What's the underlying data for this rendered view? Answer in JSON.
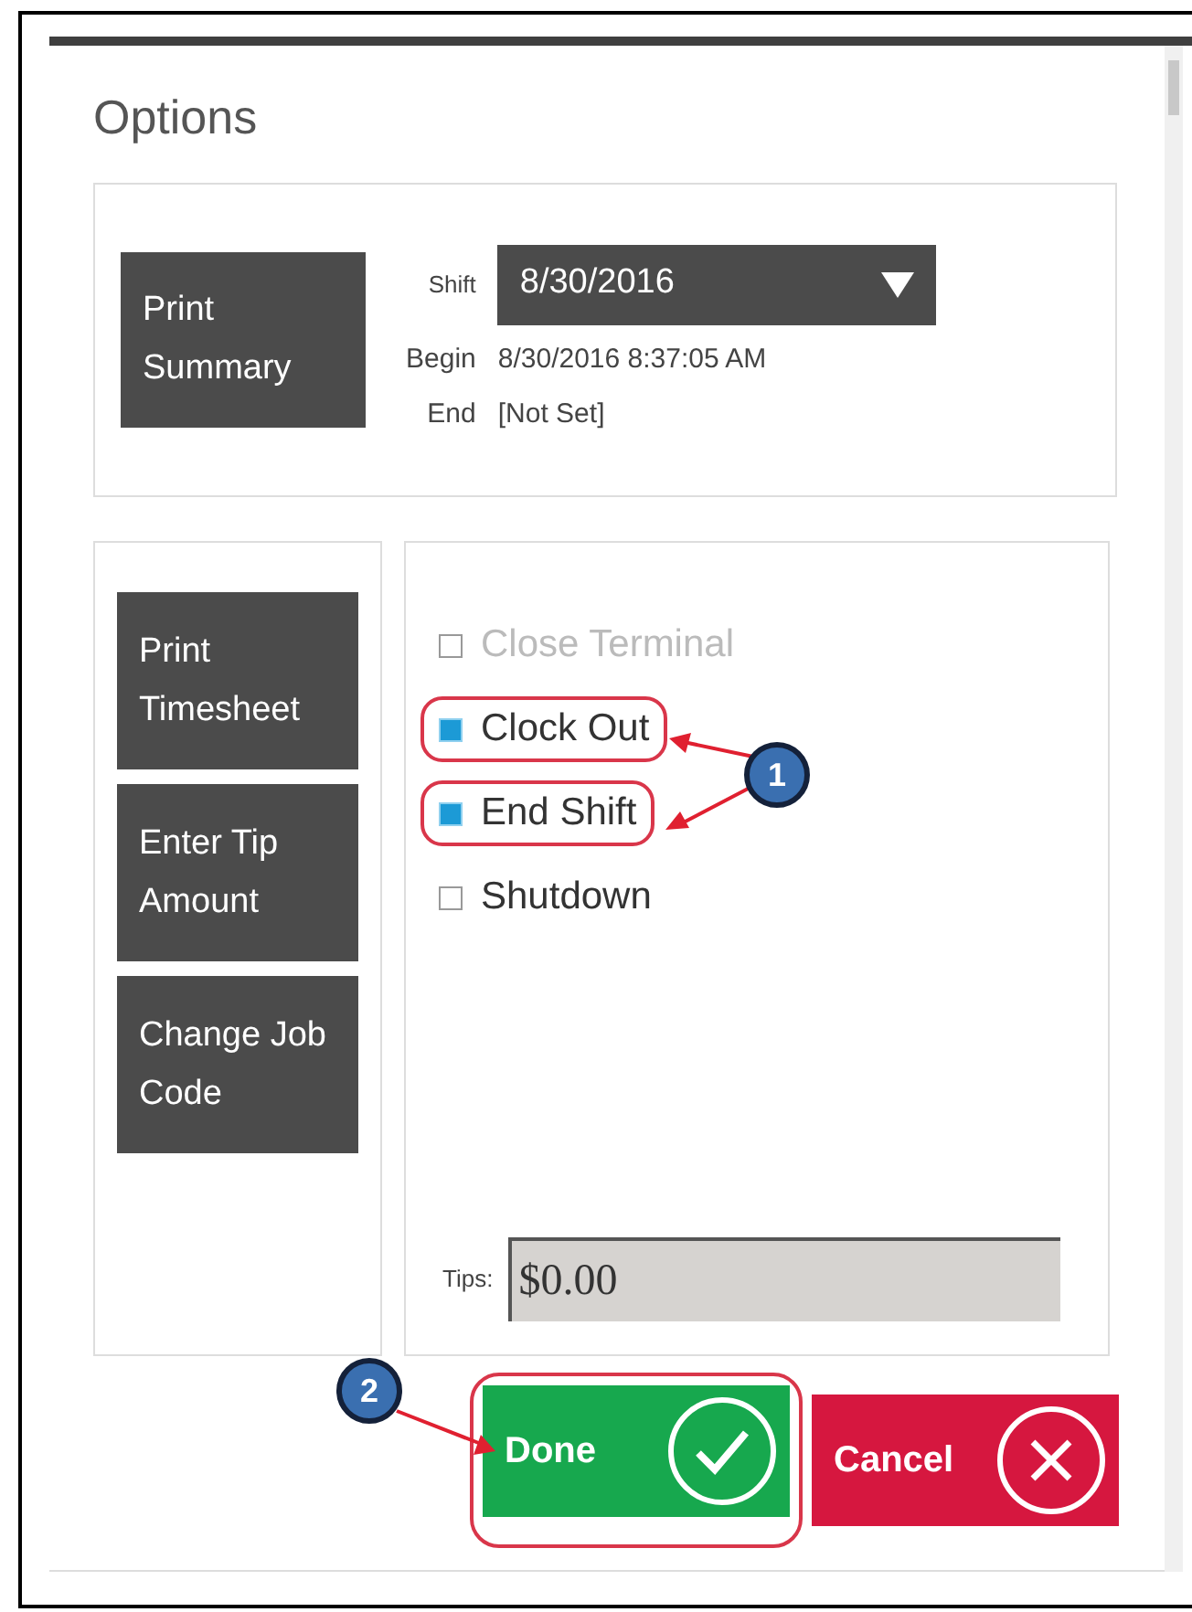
{
  "dialog": {
    "title": "Options"
  },
  "summary": {
    "button": "Print Summary",
    "shift_label": "Shift",
    "shift_value": "8/30/2016",
    "begin_label": "Begin",
    "begin_value": "8/30/2016 8:37:05 AM",
    "end_label": "End",
    "end_value": "[Not Set]"
  },
  "actions": [
    "Print Timesheet",
    "Enter Tip Amount",
    "Change Job Code"
  ],
  "options": [
    {
      "label": "Close Terminal",
      "checked": false,
      "disabled": true,
      "highlighted": false
    },
    {
      "label": "Clock Out",
      "checked": true,
      "disabled": false,
      "highlighted": true
    },
    {
      "label": "End Shift",
      "checked": true,
      "disabled": false,
      "highlighted": true
    },
    {
      "label": "Shutdown",
      "checked": false,
      "disabled": false,
      "highlighted": false
    }
  ],
  "tips": {
    "label": "Tips:",
    "value": "$0.00"
  },
  "buttons": [
    {
      "kind": "done",
      "label": "Done",
      "highlighted": true
    },
    {
      "kind": "cancel",
      "label": "Cancel",
      "highlighted": false
    }
  ],
  "callouts": [
    "1",
    "2"
  ]
}
